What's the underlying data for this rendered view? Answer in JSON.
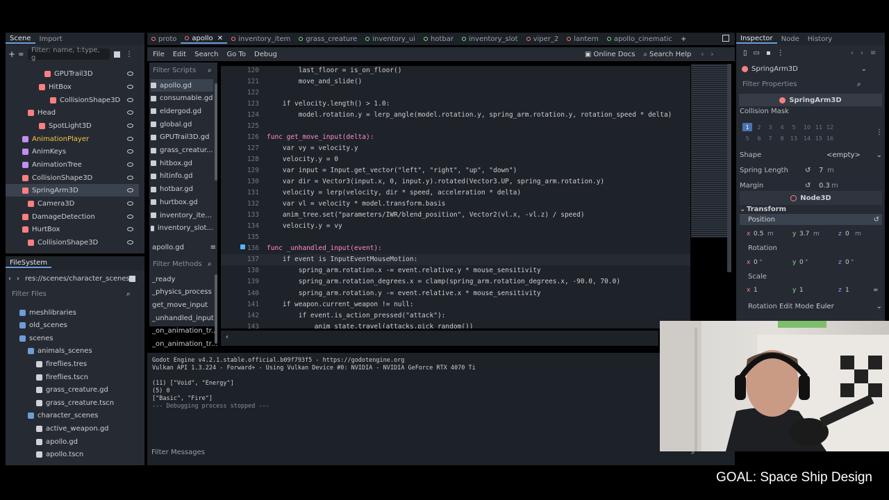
{
  "scene_dock": {
    "tabs": [
      "Scene",
      "Import"
    ],
    "filter_placeholder": "Filter: name, t:type, g",
    "nodes": [
      {
        "label": "GPUTrail3D",
        "color": "#fc7f7f"
      },
      {
        "label": "HitBox",
        "color": "#fc7f7f"
      },
      {
        "label": "CollisionShape3D",
        "color": "#fc7f7f"
      },
      {
        "label": "Head",
        "color": "#fc7f7f"
      },
      {
        "label": "SpotLight3D",
        "color": "#fc7f7f"
      },
      {
        "label": "AnimationPlayer",
        "color": "#c38ef1"
      },
      {
        "label": "AnimKeys",
        "color": "#c38ef1"
      },
      {
        "label": "AnimationTree",
        "color": "#c38ef1"
      },
      {
        "label": "CollisionShape3D",
        "color": "#fc7f7f"
      },
      {
        "label": "SpringArm3D",
        "color": "#fc7f7f"
      },
      {
        "label": "Camera3D",
        "color": "#fc7f7f"
      },
      {
        "label": "DamageDetection",
        "color": "#fc7f7f"
      },
      {
        "label": "HurtBox",
        "color": "#fc7f7f"
      },
      {
        "label": "CollisionShape3D",
        "color": "#fc7f7f"
      }
    ]
  },
  "filesystem": {
    "title": "FileSystem",
    "path": "res://scenes/character_scenes/a",
    "filter_placeholder": "Filter Files",
    "items": [
      {
        "label": "meshlibraries",
        "type": "folder"
      },
      {
        "label": "old_scenes",
        "type": "folder"
      },
      {
        "label": "scenes",
        "type": "folder"
      },
      {
        "label": "animals_scenes",
        "type": "folder"
      },
      {
        "label": "fireflies.tres",
        "type": "file"
      },
      {
        "label": "fireflies.tscn",
        "type": "file"
      },
      {
        "label": "grass_creature.gd",
        "type": "file"
      },
      {
        "label": "grass_creature.tscn",
        "type": "file"
      },
      {
        "label": "character_scenes",
        "type": "folder"
      },
      {
        "label": "active_weapon.gd",
        "type": "file"
      },
      {
        "label": "apollo.gd",
        "type": "file"
      },
      {
        "label": "apollo.tscn",
        "type": "file"
      }
    ]
  },
  "editor_tabs": [
    "proto",
    "apollo",
    "inventory_item",
    "grass_creature",
    "inventory_ui",
    "hotbar",
    "inventory_slot",
    "viper_2",
    "lantern",
    "apollo_cinematic"
  ],
  "menu": [
    "File",
    "Edit",
    "Search",
    "Go To",
    "Debug"
  ],
  "online_docs": "Online Docs",
  "search_help": "Search Help",
  "scripts": {
    "filter_placeholder": "Filter Scripts",
    "items": [
      "apollo.gd",
      "consumable.gd",
      "eldergod.gd",
      "global.gd",
      "GPUTrail3D.gd",
      "grass_creatur...",
      "hitbox.gd",
      "hitinfo.gd",
      "hotbar.gd",
      "hurtbox.gd",
      "inventory_ite...",
      "inventory_slot..."
    ],
    "current": "apollo.gd",
    "methods_placeholder": "Filter Methods",
    "methods": [
      "_ready",
      "_physics_process",
      "get_move_input",
      "_unhandled_input",
      "_on_animation_tr...",
      "_on_animation_tr..."
    ]
  },
  "code_lines": [
    {
      "n": "120",
      "t": "        last_floor = is_on_floor()"
    },
    {
      "n": "121",
      "t": "        move_and_slide()"
    },
    {
      "n": "122",
      "t": ""
    },
    {
      "n": "123",
      "t": "    if velocity.length() > 1.0:"
    },
    {
      "n": "124",
      "t": "        model.rotation.y = lerp_angle(model.rotation.y, spring_arm.rotation.y, rotation_speed * delta)"
    },
    {
      "n": "125",
      "t": ""
    },
    {
      "n": "126",
      "t": "func get_move_input(delta):"
    },
    {
      "n": "127",
      "t": "    var vy = velocity.y"
    },
    {
      "n": "128",
      "t": "    velocity.y = 0"
    },
    {
      "n": "129",
      "t": "    var input = Input.get_vector(\"left\", \"right\", \"up\", \"down\")"
    },
    {
      "n": "130",
      "t": "    var dir = Vector3(input.x, 0, input.y).rotated(Vector3.UP, spring_arm.rotation.y)"
    },
    {
      "n": "131",
      "t": "    velocity = lerp(velocity, dir * speed, acceleration * delta)"
    },
    {
      "n": "132",
      "t": "    var vl = velocity * model.transform.basis"
    },
    {
      "n": "133",
      "t": "    anim_tree.set(\"parameters/IWR/blend_position\", Vector2(vl.x, -vl.z) / speed)"
    },
    {
      "n": "134",
      "t": "    velocity.y = vy"
    },
    {
      "n": "135",
      "t": ""
    },
    {
      "n": "136",
      "t": "func _unhandled_input(event):"
    },
    {
      "n": "137",
      "t": "    if event is InputEventMouseMotion:"
    },
    {
      "n": "138",
      "t": "        spring_arm.rotation.x -= event.relative.y * mouse_sensitivity"
    },
    {
      "n": "139",
      "t": "        spring_arm.rotation_degrees.x = clamp(spring_arm.rotation_degrees.x, -90.0, 70.0)"
    },
    {
      "n": "140",
      "t": "        spring_arm.rotation.y -= event.relative.x * mouse_sensitivity"
    },
    {
      "n": "141",
      "t": "    if weapon.current_weapon != null:"
    },
    {
      "n": "142",
      "t": "        if event.is_action_pressed(\"attack\"):"
    },
    {
      "n": "143",
      "t": "            anim_state.travel(attacks.pick_random())"
    }
  ],
  "output": {
    "lines": [
      "Godot Engine v4.2.1.stable.official.b09f793f5 - https://godotengine.org",
      "Vulkan API 1.3.224 - Forward+ - Using Vulkan Device #0: NVIDIA - NVIDIA GeForce RTX 4070 Ti",
      "",
      "(11) [\"Void\", \"Energy\"]",
      "(5) 0",
      "[\"Basic\", \"Fire\"]",
      "--- Debugging process stopped ---"
    ],
    "filter_placeholder": "Filter Messages"
  },
  "inspector": {
    "tabs": [
      "Inspector",
      "Node",
      "History"
    ],
    "node": "SpringArm3D",
    "filter_placeholder": "Filter Properties",
    "section": "SpringArm3D",
    "collision_mask_label": "Collision Mask",
    "layers_row1": [
      "1",
      "2",
      "3",
      "4",
      "5",
      "10",
      "11",
      "12"
    ],
    "layers_row2": [
      "5",
      "6",
      "7",
      "8",
      "13",
      "14",
      "15",
      "16"
    ],
    "shape_label": "Shape",
    "shape_value": "<empty>",
    "spring_length_label": "Spring Length",
    "spring_length_value": "7",
    "spring_length_unit": "m",
    "margin_label": "Margin",
    "margin_value": "0.3",
    "margin_unit": "m",
    "node3d_section": "Node3D",
    "transform_section": "Transform",
    "position_label": "Position",
    "position": {
      "x": "0.5",
      "y": "3.7",
      "z": "0",
      "unit": "m"
    },
    "rotation_label": "Rotation",
    "rotation": {
      "x": "0",
      "y": "0",
      "z": "0",
      "unit": "°"
    },
    "scale_label": "Scale",
    "scale": {
      "x": "1",
      "y": "1",
      "z": "1"
    },
    "rotation_edit_mode_label": "Rotation Edit Mode",
    "rotation_edit_mode_value": "Euler"
  },
  "goal_text": "GOAL: Space Ship Design",
  "colors": {
    "accent": "#6d9dda",
    "node3d": "#fc7f7f",
    "anim": "#c38ef1",
    "keyword": "#ff7085",
    "function": "#57b3ff",
    "string": "#ffeda1"
  }
}
